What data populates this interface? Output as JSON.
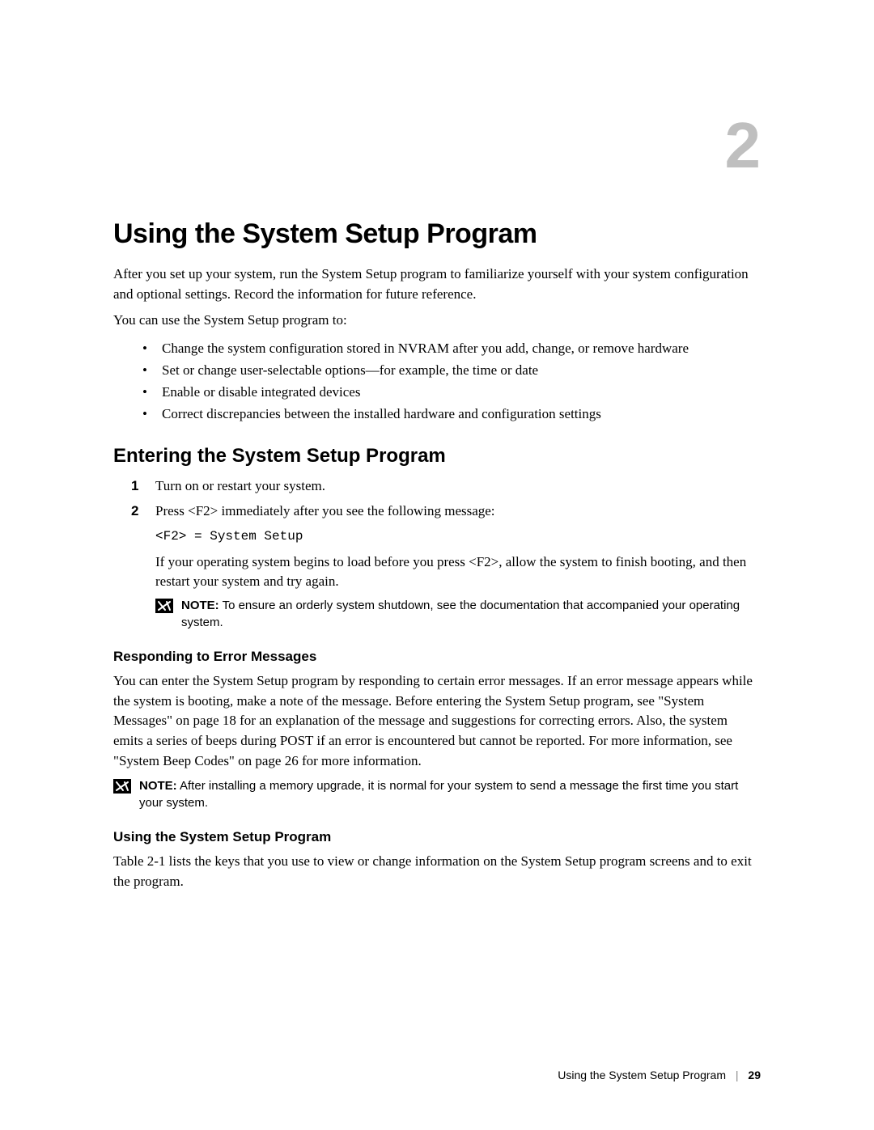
{
  "chapter": {
    "number": "2",
    "title": "Using the System Setup Program"
  },
  "intro": {
    "p1": "After you set up your system, run the System Setup program to familiarize yourself with your system configuration and optional settings. Record the information for future reference.",
    "p2": "You can use the System Setup program to:",
    "bullets": [
      "Change the system configuration stored in NVRAM after you add, change, or remove hardware",
      "Set or change user-selectable options—for example, the time or date",
      "Enable or disable integrated devices",
      "Correct discrepancies between the installed hardware and configuration settings"
    ]
  },
  "entering": {
    "heading": "Entering the System Setup Program",
    "steps": {
      "s1": "Turn on or restart your system.",
      "s2": "Press <F2> immediately after you see the following message:",
      "code": "<F2> = System Setup",
      "s2_after": "If your operating system begins to load before you press <F2>, allow the system to finish booting, and then restart your system and try again."
    },
    "note": {
      "label": "NOTE:",
      "text": " To ensure an orderly system shutdown, see the documentation that accompanied your operating system."
    }
  },
  "responding": {
    "heading": "Responding to Error Messages",
    "p1": "You can enter the System Setup program by responding to certain error messages. If an error message appears while the system is booting, make a note of the message. Before entering the System Setup program, see \"System Messages\" on page 18 for an explanation of the message and suggestions for correcting errors. Also, the system emits a series of beeps during POST if an error is encountered but cannot be reported. For more information, see \"System Beep Codes\" on page 26 for more information.",
    "note": {
      "label": "NOTE:",
      "text": " After installing a memory upgrade, it is normal for your system to send a message the first time you start your system."
    }
  },
  "using": {
    "heading": "Using the System Setup Program",
    "p1": "Table 2-1 lists the keys that you use to view or change information on the System Setup program screens and to exit the program."
  },
  "footer": {
    "title": "Using the System Setup Program",
    "page": "29"
  }
}
